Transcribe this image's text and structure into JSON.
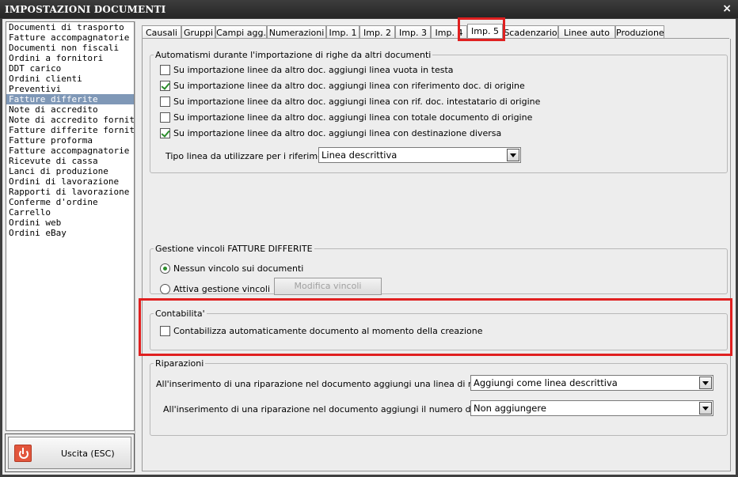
{
  "window": {
    "title": "IMPOSTAZIONI DOCUMENTI",
    "close_glyph": "×"
  },
  "sidebar": {
    "selected": "Fatture differite",
    "items": [
      "Documenti di trasporto",
      "Fatture accompagnatorie",
      "Documenti non fiscali",
      "Ordini a fornitori",
      "DDT carico",
      "Ordini clienti",
      "Preventivi",
      "Fatture differite",
      "Note di accredito",
      "Note di accredito fornitori",
      "Fatture differite fornitori",
      "Fatture proforma",
      "Fatture accompagnatorie fc",
      "Ricevute di cassa",
      "Lanci di produzione",
      "Ordini di lavorazione",
      "Rapporti di lavorazione",
      "Conferme d'ordine",
      "Carrello",
      "Ordini web",
      "Ordini eBay"
    ]
  },
  "exit_button": {
    "label": "Uscita (ESC)",
    "icon": "power-icon"
  },
  "tabs": {
    "items": [
      "Causali",
      "Gruppi",
      "Campi agg.",
      "Numerazioni",
      "Imp. 1",
      "Imp. 2",
      "Imp. 3",
      "Imp. 4",
      "Imp. 5",
      "Scadenzario",
      "Linee auto",
      "Produzione"
    ],
    "active": "Imp. 5"
  },
  "import_group": {
    "legend": "Automatismi durante l'importazione di righe da altri documenti",
    "options": [
      {
        "label": "Su importazione linee da altro doc. aggiungi linea vuota in testa",
        "checked": false
      },
      {
        "label": "Su importazione linee da altro doc. aggiungi linea con riferimento doc. di origine",
        "checked": true
      },
      {
        "label": "Su importazione linee da altro doc. aggiungi linea con rif. doc. intestatario di origine",
        "checked": false
      },
      {
        "label": "Su importazione linee da altro doc. aggiungi linea con totale documento di origine",
        "checked": false
      },
      {
        "label": "Su importazione linee da altro doc. aggiungi linea con destinazione diversa",
        "checked": true
      }
    ],
    "line_type_label": "Tipo linea da utilizzare per i riferimenti :",
    "line_type_value": "Linea descrittiva"
  },
  "vincoli_group": {
    "legend": "Gestione vincoli FATTURE DIFFERITE",
    "option_none": "Nessun vincolo sui documenti",
    "option_active": "Attiva gestione vincoli",
    "selected": "none",
    "modify_button": "Modifica vincoli"
  },
  "contabilita_group": {
    "legend": "Contabilita'",
    "option": "Contabilizza automaticamente documento al momento della creazione",
    "checked": false
  },
  "riparazioni_group": {
    "legend": "Riparazioni",
    "ref_line_label": "All'inserimento di una riparazione nel documento aggiungi una linea di riferimento :",
    "ref_line_value": "Aggiungi come linea descrittiva",
    "serial_label": "All'inserimento di una riparazione nel documento aggiungi il numero di matricola :",
    "serial_value": "Non aggiungere"
  },
  "colors": {
    "highlight_red": "#e02020",
    "title_bar": "#2f2f2f",
    "selection": "#7f98b7",
    "check_green": "#2a8c2a"
  }
}
